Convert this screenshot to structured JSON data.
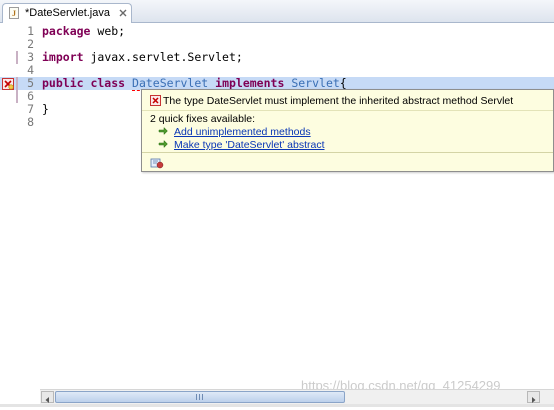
{
  "tab": {
    "title": "*DateServlet.java",
    "close_icon": "close-icon",
    "file_icon": "java-file-icon"
  },
  "editor": {
    "lines": [
      {
        "number": "1"
      },
      {
        "number": "2"
      },
      {
        "number": "3"
      },
      {
        "number": "4"
      },
      {
        "number": "5"
      },
      {
        "number": "6"
      },
      {
        "number": "7"
      },
      {
        "number": "8"
      }
    ],
    "code": {
      "l1_kw": "package",
      "l1_rest": " web;",
      "l3_kw": "import",
      "l3_rest": " javax.servlet.Servlet;",
      "l5_kw1": "public class",
      "l5_space1": " ",
      "l5_class": "DateServlet",
      "l5_space2": " ",
      "l5_kw2": "implements",
      "l5_space3": " ",
      "l5_iface": "Servlet",
      "l5_brace": "{",
      "l7_brace": "}"
    },
    "current_line": 5,
    "error_marker_icon": "error-marker-icon"
  },
  "quick_fix": {
    "message": "The type DateServlet must implement the inherited abstract method Servlet",
    "count_text": "2 quick fixes available:",
    "fixes": [
      {
        "label": "Add unimplemented methods",
        "icon": "quick-fix-arrow-icon"
      },
      {
        "label": "Make type 'DateServlet' abstract",
        "icon": "quick-fix-arrow-icon"
      }
    ],
    "footer_icon": "configure-problem-icon"
  },
  "watermark": "https://blog.csdn.net/qq_41254299",
  "colors": {
    "keyword": "#7f0055",
    "current_line": "#c6daf6",
    "hover_bg": "#fdfde0",
    "link": "#0a37b5"
  }
}
